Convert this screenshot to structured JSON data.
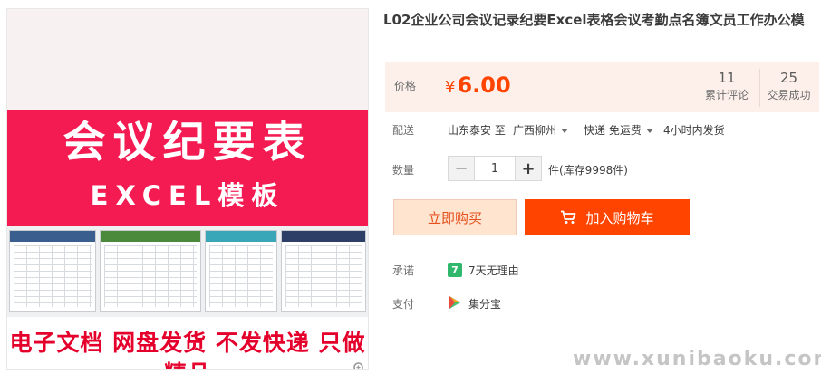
{
  "product": {
    "title": "L02企业公司会议记录纪要Excel表格会议考勤点名簿文员工作办公模",
    "image": {
      "headline": "会议纪要表",
      "subline": "EXCEL模板",
      "slogan": "电子文档  网盘发货  不发快递  只做精品"
    }
  },
  "price": {
    "label": "价格",
    "currency": "¥",
    "amount": "6.00",
    "reviews_count": "11",
    "reviews_label": "累计评论",
    "sales_count": "25",
    "sales_label": "交易成功"
  },
  "shipping": {
    "label": "配送",
    "from": "山东泰安 至",
    "to": "广西柳州",
    "method": "快递 免运费",
    "time": "4小时内发货"
  },
  "quantity": {
    "label": "数量",
    "minus": "−",
    "value": "1",
    "plus": "+",
    "stock": "件(库存9998件)"
  },
  "actions": {
    "buy_now": "立即购买",
    "add_to_cart": "加入购物车"
  },
  "promise": {
    "label": "承诺",
    "badge": "7",
    "text": "7天无理由"
  },
  "payment": {
    "label": "支付",
    "text": "集分宝"
  },
  "watermark": "www.xunibaoku.com",
  "colors": {
    "accent": "#ff4400",
    "price": "#ff4400",
    "banner": "#f41b52",
    "promise_badge": "#2fb86b"
  }
}
